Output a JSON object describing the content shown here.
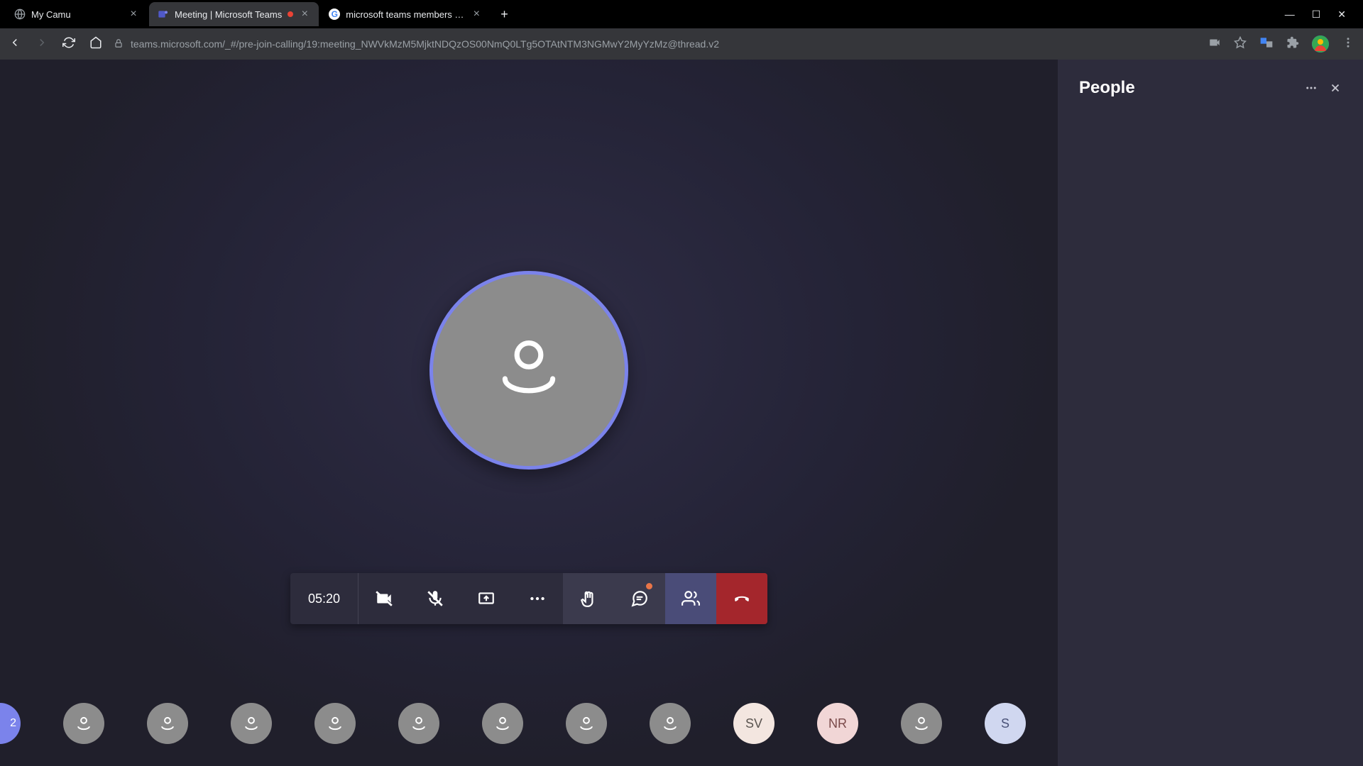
{
  "browser": {
    "tabs": [
      {
        "title": "My Camu",
        "active": false
      },
      {
        "title": "Meeting | Microsoft Teams",
        "active": true,
        "recording": true
      },
      {
        "title": "microsoft teams members not sh",
        "active": false
      }
    ],
    "url": "teams.microsoft.com/_#/pre-join-calling/19:meeting_NWVkMzM5MjktNDQzOS00NmQ0LTg5OTAtNTM3NGMwY2MyYzMz@thread.v2"
  },
  "meeting": {
    "timer": "05:20",
    "controls": {
      "camera": "camera-off",
      "mic": "mic-off",
      "share": "share",
      "more": "more",
      "raise_hand": "raise-hand",
      "chat": "chat",
      "people": "people",
      "hangup": "hangup"
    }
  },
  "participants_strip": [
    {
      "type": "partial",
      "text": "2"
    },
    {
      "type": "icon"
    },
    {
      "type": "icon"
    },
    {
      "type": "icon"
    },
    {
      "type": "icon"
    },
    {
      "type": "icon"
    },
    {
      "type": "icon"
    },
    {
      "type": "icon"
    },
    {
      "type": "icon"
    },
    {
      "type": "initials",
      "text": "SV",
      "variant": "sv"
    },
    {
      "type": "initials",
      "text": "NR",
      "variant": "nr"
    },
    {
      "type": "icon"
    },
    {
      "type": "initials",
      "text": "S",
      "variant": "s"
    }
  ],
  "side_panel": {
    "title": "People"
  }
}
